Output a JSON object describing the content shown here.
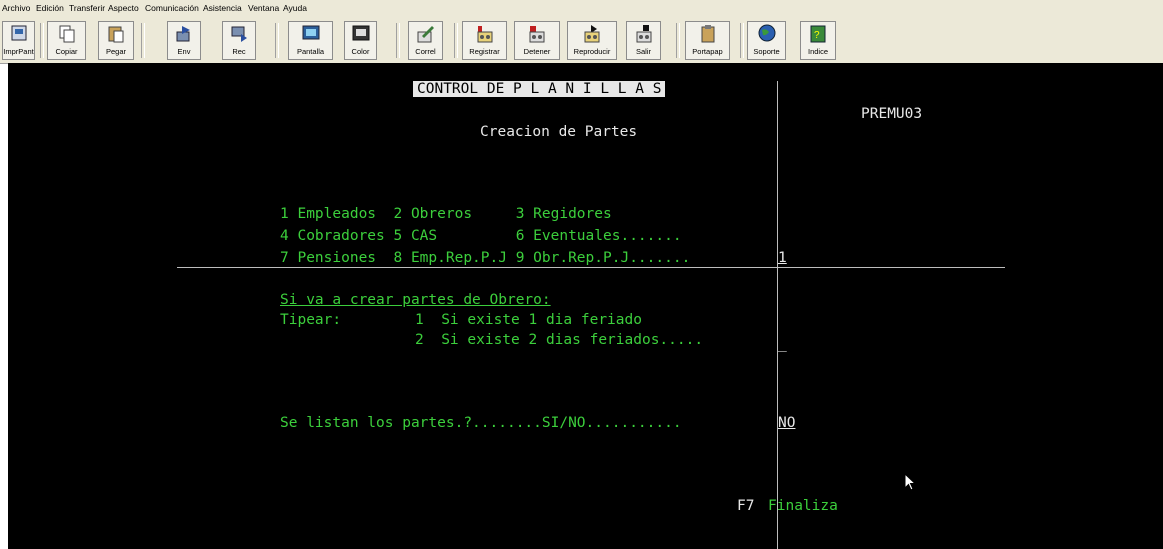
{
  "menu": [
    "Archivo",
    "Edición",
    "Transferir",
    "Aspecto",
    "Comunicación",
    "Asistencia",
    "Ventana",
    "Ayuda"
  ],
  "toolbar": {
    "buttons": [
      {
        "label": "ImprPant",
        "icon": "printer-icon"
      },
      {
        "label": "Copiar",
        "icon": "copy-icon"
      },
      {
        "label": "Pegar",
        "icon": "paste-icon"
      },
      {
        "label": "Env",
        "icon": "send-icon"
      },
      {
        "label": "Rec",
        "icon": "receive-icon"
      },
      {
        "label": "Pantalla",
        "icon": "screen-icon"
      },
      {
        "label": "Color",
        "icon": "color-icon"
      },
      {
        "label": "Correl",
        "icon": "edit-icon"
      },
      {
        "label": "Registrar",
        "icon": "record-icon"
      },
      {
        "label": "Detener",
        "icon": "stop-icon"
      },
      {
        "label": "Reproducir",
        "icon": "play-icon"
      },
      {
        "label": "Salir",
        "icon": "exit-icon"
      },
      {
        "label": "Portapap",
        "icon": "clipboard-icon"
      },
      {
        "label": "Soporte",
        "icon": "globe-icon"
      },
      {
        "label": "Indice",
        "icon": "book-icon"
      }
    ]
  },
  "screen": {
    "title": "CONTROL DE P L A N I L L A S",
    "program_id": "PREMU03",
    "subtitle": "Creacion de Partes",
    "options_row1": "1 Empleados  2 Obreros     3 Regidores",
    "options_row2": "4 Cobradores 5 CAS         6 Eventuales.......",
    "options_row3": "7 Pensiones  8 Emp.Rep.P.J 9 Obr.Rep.P.J.......",
    "option_value": "1",
    "obrero_heading": "Si va a crear partes de Obrero:",
    "tipear_label": "Tipear:",
    "feriado_opt1": "1  Si existe 1 dia feriado",
    "feriado_opt2": "2  Si existe 2 dias feriados.....",
    "feriado_value": "_",
    "listar_prompt": "Se listan los partes.?........SI/NO...........",
    "listar_value": "NO",
    "fkey": "F7",
    "fkey_label": "Finaliza"
  }
}
